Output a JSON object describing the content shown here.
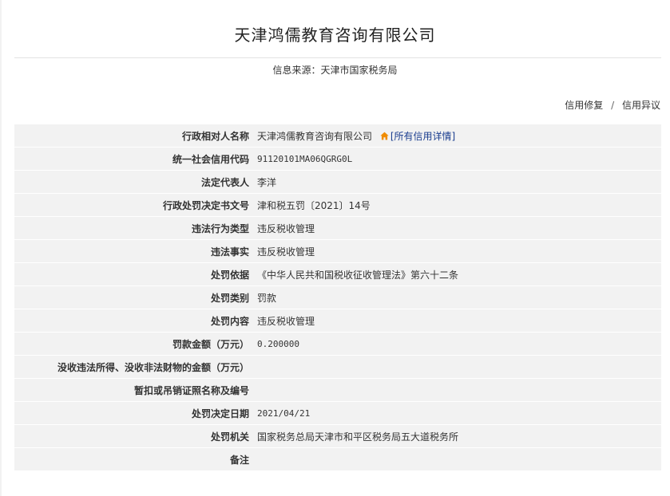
{
  "page": {
    "title": "天津鸿儒教育咨询有限公司",
    "source_label": "信息来源：",
    "source_value": "天津市国家税务局"
  },
  "actions": {
    "repair": "信用修复",
    "separator": "/",
    "objection": "信用异议"
  },
  "detail_link": {
    "icon": "home-icon",
    "icon_color": "#f08c00",
    "text": "[所有信用详情]"
  },
  "rows": [
    {
      "label": "行政相对人名称",
      "value": "天津鸿儒教育咨询有限公司"
    },
    {
      "label": "统一社会信用代码",
      "value": "91120101MA06QGRG0L"
    },
    {
      "label": "法定代表人",
      "value": "李洋"
    },
    {
      "label": "行政处罚决定书文号",
      "value": "津和税五罚〔2021〕14号"
    },
    {
      "label": "违法行为类型",
      "value": "违反税收管理"
    },
    {
      "label": "违法事实",
      "value": "违反税收管理"
    },
    {
      "label": "处罚依据",
      "value": "《中华人民共和国税收征收管理法》第六十二条"
    },
    {
      "label": "处罚类别",
      "value": "罚款"
    },
    {
      "label": "处罚内容",
      "value": "违反税收管理"
    },
    {
      "label": "罚款金额（万元）",
      "value": "0.200000"
    },
    {
      "label": "没收违法所得、没收非法财物的金额（万元）",
      "value": ""
    },
    {
      "label": "暂扣或吊销证照名称及编号",
      "value": ""
    },
    {
      "label": "处罚决定日期",
      "value": "2021/04/21"
    },
    {
      "label": "处罚机关",
      "value": "国家税务总局天津市和平区税务局五大道税务所"
    },
    {
      "label": "备注",
      "value": ""
    }
  ]
}
